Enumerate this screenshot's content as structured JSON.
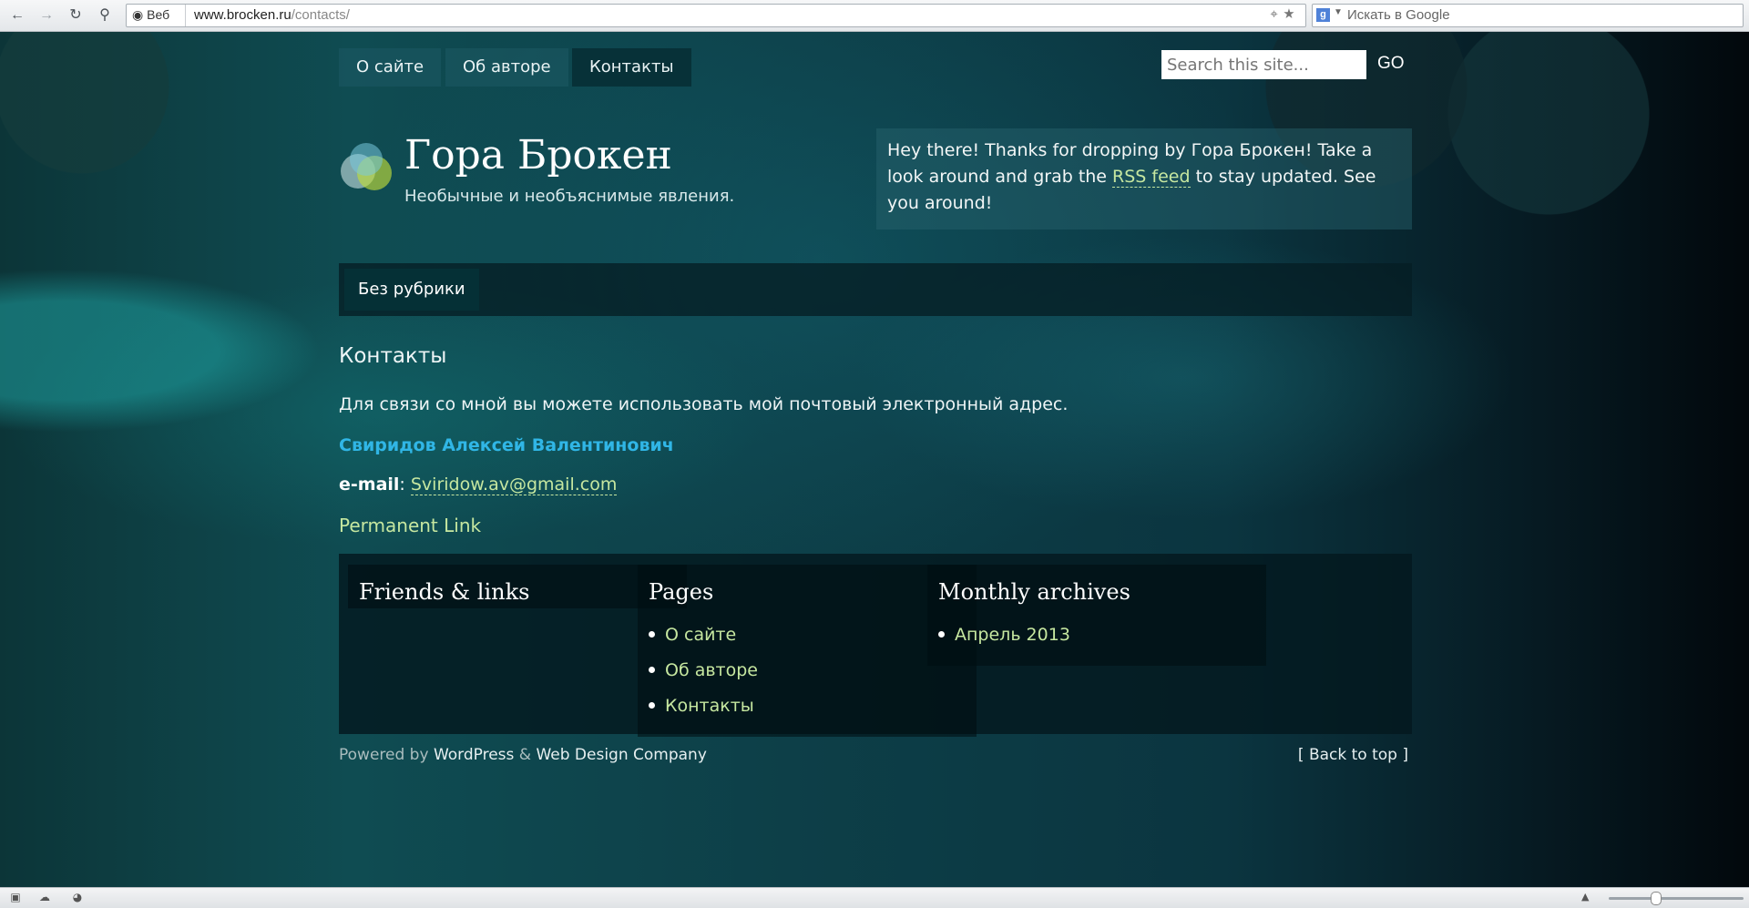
{
  "browser": {
    "url_domain": "www.brocken.ru",
    "url_path": "/contacts/",
    "web_label": "Веб",
    "search_placeholder": "Искать в Google"
  },
  "nav": [
    {
      "label": "О сайте",
      "active": false
    },
    {
      "label": "Об авторе",
      "active": false
    },
    {
      "label": "Контакты",
      "active": true
    }
  ],
  "search": {
    "placeholder": "Search this site...",
    "go_label": "GO"
  },
  "site": {
    "title": "Гора Брокен",
    "description": "Необычные и необъяснимые явления."
  },
  "welcome": {
    "text_before": "Hey there! Thanks for dropping by Гора Брокен! Take a look around and grab the ",
    "link": "RSS feed",
    "text_after": " to stay updated. See you around!"
  },
  "category": {
    "label": "Без рубрики"
  },
  "post": {
    "title": "Контакты",
    "text": "Для связи со мной вы можете использовать мой почтовый электронный адрес.",
    "name": "Свиридов Алексей Валентинович",
    "email_label": "e-mail",
    "email_separator": ": ",
    "email": "Sviridow.av@gmail.com",
    "permalink": "Permanent Link"
  },
  "widgets": [
    {
      "title": "Friends & links",
      "items": []
    },
    {
      "title": "Pages",
      "items": [
        "О сайте",
        "Об авторе",
        "Контакты"
      ]
    },
    {
      "title": "Monthly archives",
      "items": [
        "Апрель 2013"
      ]
    }
  ],
  "footer": {
    "powered": "Powered by",
    "wordpress": "WordPress",
    "amp": "&",
    "company": "Web Design Company",
    "back_to_top": "[ Back to top ]"
  },
  "colors": {
    "accent_link": "#c6e7a0",
    "name_blue": "#30b6e6",
    "active_nav": "#073138"
  }
}
